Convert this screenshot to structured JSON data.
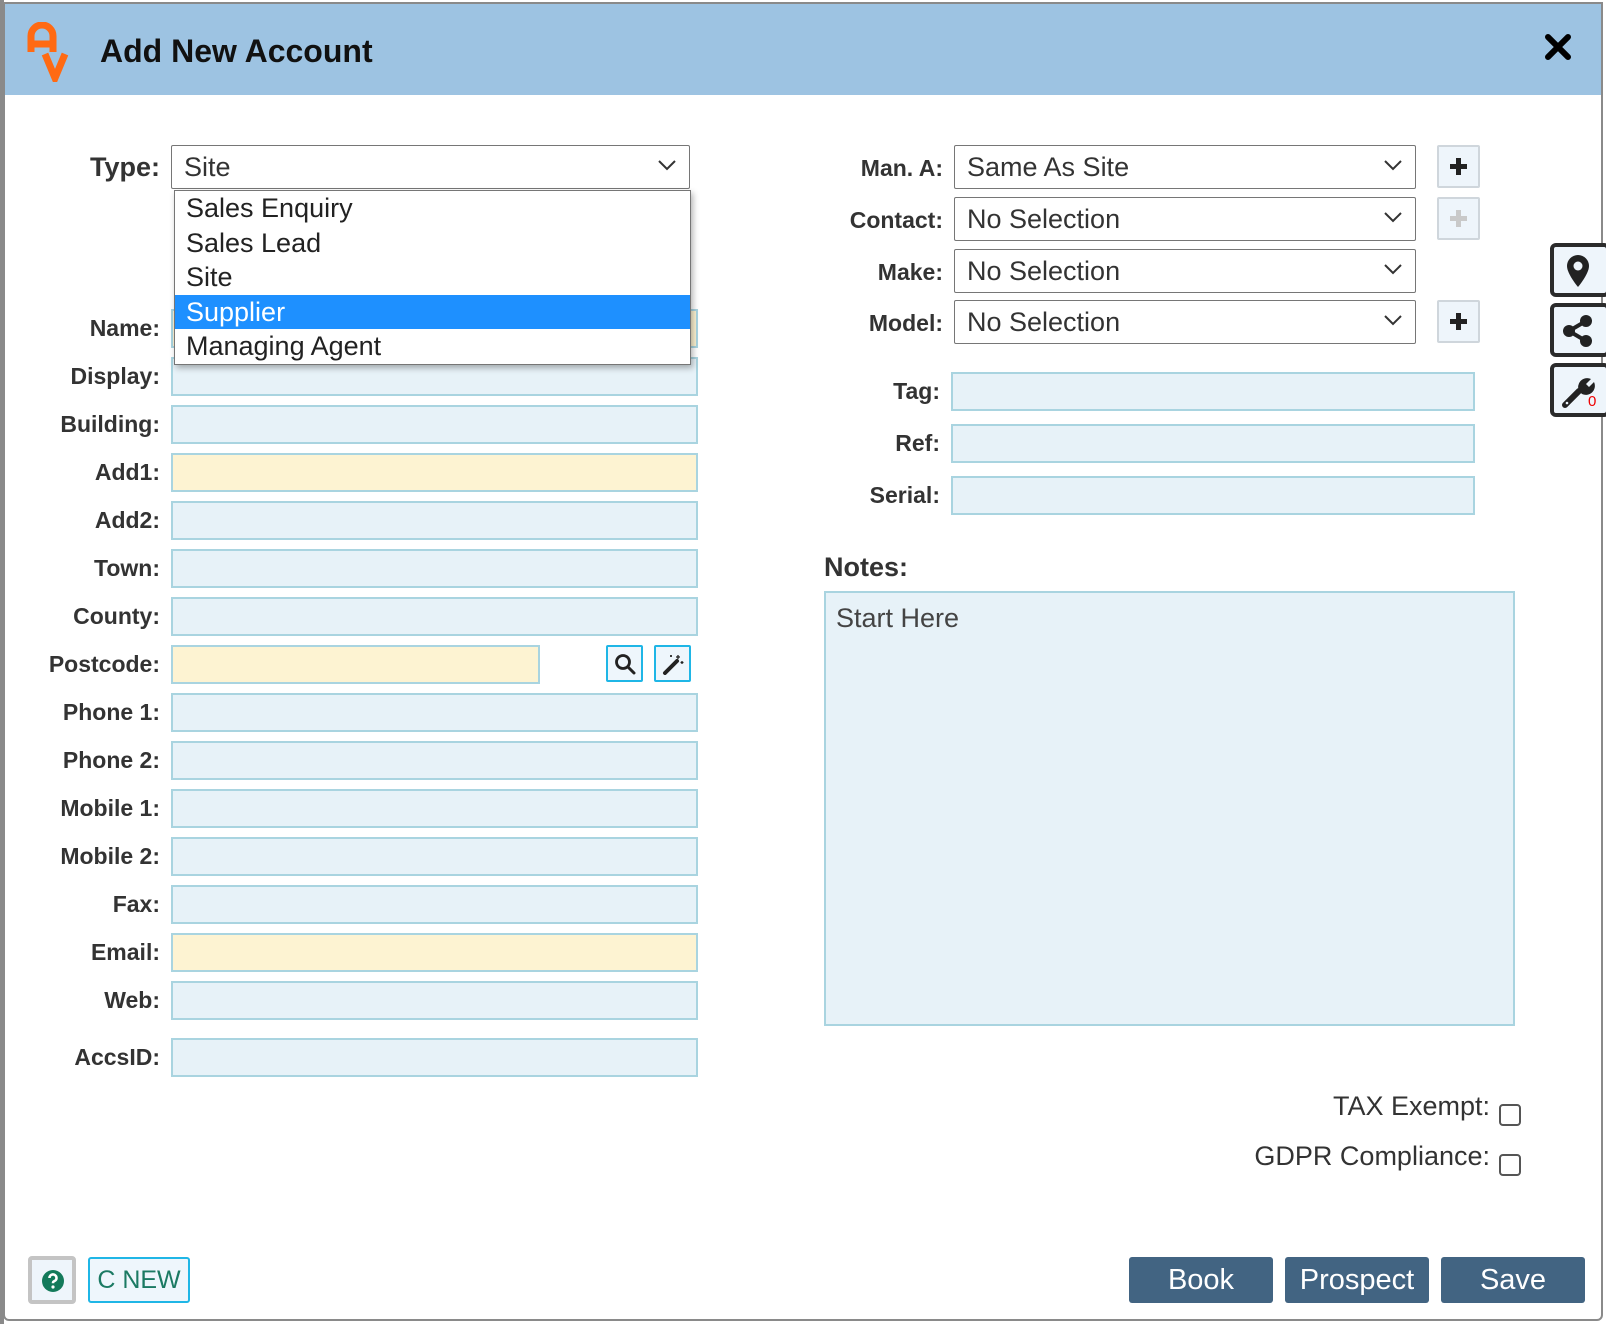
{
  "dialog": {
    "title": "Add New Account",
    "logo_icon": "av-logo-icon",
    "close_icon": "close-icon"
  },
  "colors": {
    "header_bg": "#9dc3e2",
    "field_bg": "#e7f2f8",
    "required_field_bg": "#fdf3d2",
    "field_border": "#a9d4e0",
    "selected_option_bg": "#1e90ff",
    "primary_button_bg": "#426482",
    "logo_orange": "#ff6a13",
    "help_icon_green": "#137a5a",
    "badge_red": "#e00000"
  },
  "type_select": {
    "label": "Type:",
    "value": "Site",
    "open": true,
    "options": [
      {
        "label": "Sales Enquiry",
        "highlighted": false
      },
      {
        "label": "Sales Lead",
        "highlighted": false
      },
      {
        "label": "Site",
        "highlighted": false
      },
      {
        "label": "Supplier",
        "highlighted": true
      },
      {
        "label": "Managing Agent",
        "highlighted": false
      }
    ]
  },
  "left_fields": [
    {
      "label": "Name:",
      "value": "",
      "required": true
    },
    {
      "label": "Display:",
      "value": "",
      "required": false
    },
    {
      "label": "Building:",
      "value": "",
      "required": false
    },
    {
      "label": "Add1:",
      "value": "",
      "required": true
    },
    {
      "label": "Add2:",
      "value": "",
      "required": false
    },
    {
      "label": "Town:",
      "value": "",
      "required": false
    },
    {
      "label": "County:",
      "value": "",
      "required": false
    },
    {
      "label": "Postcode:",
      "value": "",
      "required": true
    },
    {
      "label": "Phone 1:",
      "value": "",
      "required": false
    },
    {
      "label": "Phone 2:",
      "value": "",
      "required": false
    },
    {
      "label": "Mobile 1:",
      "value": "",
      "required": false
    },
    {
      "label": "Mobile 2:",
      "value": "",
      "required": false
    },
    {
      "label": "Fax:",
      "value": "",
      "required": false
    },
    {
      "label": "Email:",
      "value": "",
      "required": true
    },
    {
      "label": "Web:",
      "value": "",
      "required": false
    },
    {
      "label": "AccsID:",
      "value": "",
      "required": false
    }
  ],
  "postcode_tools": {
    "search_icon": "search-icon",
    "wand_icon": "magic-wand-icon"
  },
  "right_selects": [
    {
      "label": "Man. A:",
      "value": "Same As Site",
      "add_button": "enabled"
    },
    {
      "label": "Contact:",
      "value": "No Selection",
      "add_button": "disabled"
    },
    {
      "label": "Make:",
      "value": "No Selection",
      "add_button": "none"
    },
    {
      "label": "Model:",
      "value": "No Selection",
      "add_button": "enabled"
    }
  ],
  "right_fields": [
    {
      "label": "Tag:",
      "value": ""
    },
    {
      "label": "Ref:",
      "value": ""
    },
    {
      "label": "Serial:",
      "value": ""
    }
  ],
  "notes": {
    "label": "Notes:",
    "value": "Start Here"
  },
  "checkboxes": [
    {
      "label": "TAX Exempt:",
      "checked": false
    },
    {
      "label": "GDPR Compliance:",
      "checked": false
    }
  ],
  "side_tabs": [
    {
      "icon": "map-marker-icon"
    },
    {
      "icon": "share-icon"
    },
    {
      "icon": "wrench-icon",
      "badge": "0"
    }
  ],
  "footer": {
    "help_icon": "question-circle-icon",
    "cnew_label": "C NEW",
    "book_label": "Book",
    "prospect_label": "Prospect",
    "save_label": "Save"
  }
}
